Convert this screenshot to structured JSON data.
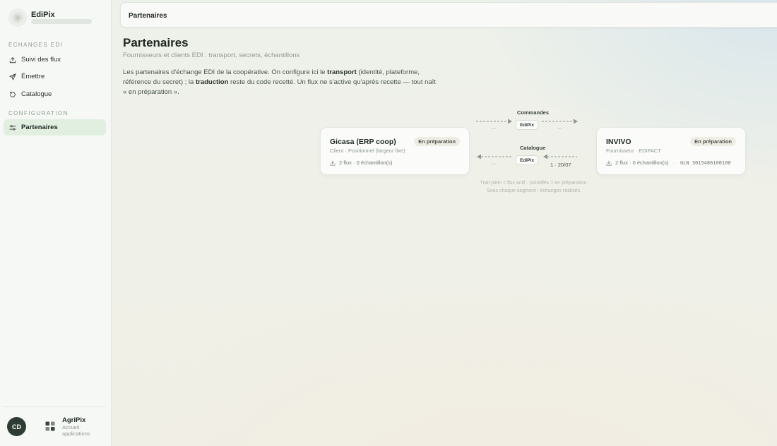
{
  "app": {
    "name": "EdiPix"
  },
  "sidebar": {
    "sections": [
      {
        "label": "ÉCHANGES EDI"
      },
      {
        "label": "CONFIGURATION"
      }
    ],
    "items": [
      {
        "label": "Suivi des flux",
        "icon": "upload-tray-icon"
      },
      {
        "label": "Émettre",
        "icon": "send-icon"
      },
      {
        "label": "Catalogue",
        "icon": "history-icon"
      },
      {
        "label": "Partenaires",
        "icon": "sliders-icon",
        "active": true
      }
    ],
    "footer": {
      "avatar_initials": "CD",
      "apps_name": "AgriPix",
      "apps_sub": "Accueil applications"
    }
  },
  "topbar": {
    "title": "Partenaires"
  },
  "page": {
    "title": "Partenaires",
    "subtitle": "Fournisseurs et clients EDI : transport, secrets, échantillons",
    "intro": {
      "p1": "Les partenaires d'échange EDI de la coopérative. On configure ici le ",
      "b1": "transport",
      "p2": " (identité, plateforme, référence du secret) ; la ",
      "b2": "traduction",
      "p3": " reste du code recetté. Un flux ne s'active qu'après recette — tout naît « en préparation »."
    }
  },
  "partners": {
    "left": {
      "name": "Gicasa (ERP coop)",
      "sub": "Client · Positionnel (largeur fixe)",
      "badge": "En préparation",
      "stats": "2 flux · 0 échantillon(s)"
    },
    "right": {
      "name": "INVIVO",
      "sub": "Fournisseur · EDIFACT",
      "badge": "En préparation",
      "stats": "2 flux · 0 échantillon(s)",
      "gln": "GLN 3015486100100"
    }
  },
  "flows": {
    "hub": "EdiPix",
    "commandes": {
      "label": "Commandes",
      "left_count": "—",
      "right_count": "—"
    },
    "catalogue": {
      "label": "Catalogue",
      "left_count": "—",
      "right_count": "1 · 20/07"
    }
  },
  "legend": {
    "line1": "Trait plein = flux actif · pointillés = en préparation.",
    "line2": "Sous chaque segment : échanges réalisés."
  },
  "colors": {
    "active_nav_bg": "#e1efe1",
    "avatar_bg": "#2f3c33",
    "badge_bg": "#efece4"
  }
}
